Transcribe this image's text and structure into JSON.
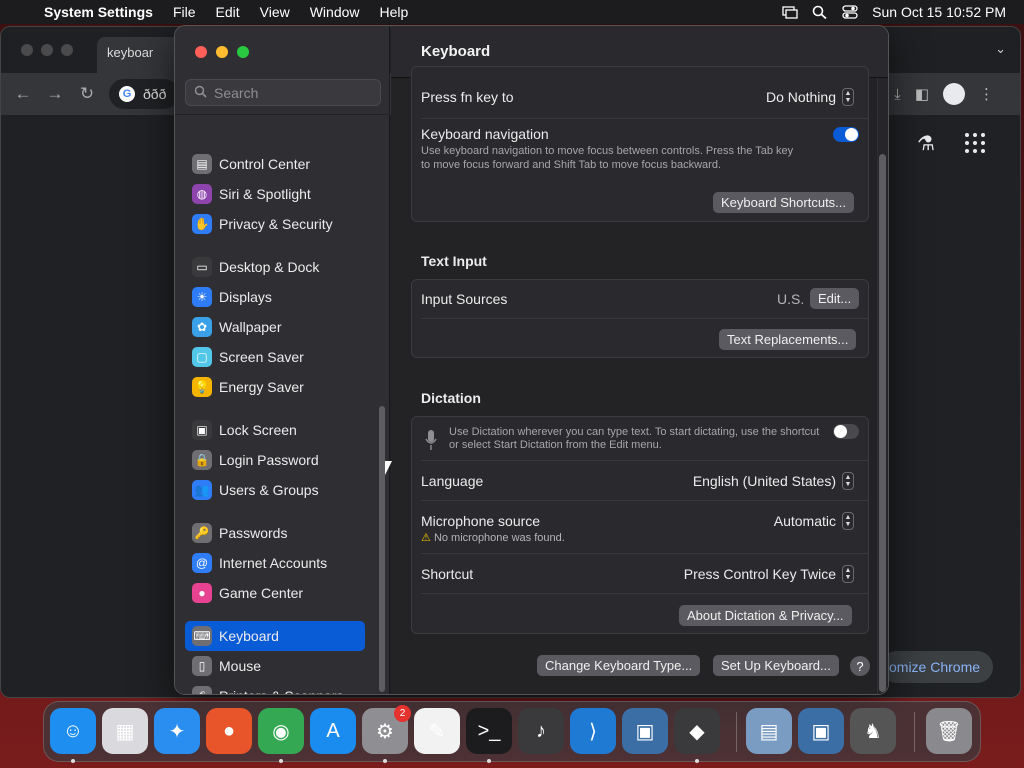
{
  "menubar": {
    "app": "System Settings",
    "items": [
      "File",
      "Edit",
      "View",
      "Window",
      "Help"
    ],
    "datetime": "Sun Oct 15  10:52 PM"
  },
  "chrome": {
    "tab_title": "keyboar",
    "omnibox_text": "ððð",
    "customize_label": "omize Chrome"
  },
  "sidebar": {
    "search_placeholder": "Search",
    "items": [
      {
        "label": "Control Center",
        "icon": "control-center-icon",
        "color": "#6e6e73"
      },
      {
        "label": "Siri & Spotlight",
        "icon": "siri-icon",
        "color": "#8e44ad"
      },
      {
        "label": "Privacy & Security",
        "icon": "hand-icon",
        "color": "#2e7cf6"
      },
      {
        "label": "Desktop & Dock",
        "icon": "dock-icon",
        "color": "#3a3a3c"
      },
      {
        "label": "Displays",
        "icon": "sun-icon",
        "color": "#2e7cf6"
      },
      {
        "label": "Wallpaper",
        "icon": "flower-icon",
        "color": "#3aa0e8"
      },
      {
        "label": "Screen Saver",
        "icon": "screen-saver-icon",
        "color": "#52c7e8"
      },
      {
        "label": "Energy Saver",
        "icon": "bulb-icon",
        "color": "#f4b400"
      },
      {
        "label": "Lock Screen",
        "icon": "lock-screen-icon",
        "color": "#3a3a3c"
      },
      {
        "label": "Login Password",
        "icon": "lock-icon",
        "color": "#6e6e73"
      },
      {
        "label": "Users & Groups",
        "icon": "users-icon",
        "color": "#2e7cf6"
      },
      {
        "label": "Passwords",
        "icon": "key-icon",
        "color": "#6e6e73"
      },
      {
        "label": "Internet Accounts",
        "icon": "at-icon",
        "color": "#2e7cf6"
      },
      {
        "label": "Game Center",
        "icon": "game-center-icon",
        "color": "#e84393"
      },
      {
        "label": "Keyboard",
        "icon": "keyboard-icon",
        "color": "#6e6e73"
      },
      {
        "label": "Mouse",
        "icon": "mouse-icon",
        "color": "#6e6e73"
      },
      {
        "label": "Printers & Scanners",
        "icon": "printer-icon",
        "color": "#6e6e73"
      }
    ],
    "selected": "Keyboard"
  },
  "main": {
    "title": "Keyboard",
    "fn_key": {
      "label": "Press fn key to",
      "value": "Do Nothing"
    },
    "keyboard_navigation": {
      "label": "Keyboard navigation",
      "description_1": "Use keyboard navigation to move focus between controls. Press the Tab key",
      "description_2": "to move focus forward and Shift Tab to move focus backward.",
      "enabled": true
    },
    "keyboard_shortcuts_button": "Keyboard Shortcuts...",
    "text_input": {
      "title": "Text Input",
      "input_sources_label": "Input Sources",
      "input_sources_value": "U.S.",
      "edit_button": "Edit...",
      "text_replacements_button": "Text Replacements..."
    },
    "dictation": {
      "title": "Dictation",
      "description_1": "Use Dictation wherever you can type text. To start dictating, use the shortcut",
      "description_2": "or select Start Dictation from the Edit menu.",
      "enabled": false,
      "language_label": "Language",
      "language_value": "English (United States)",
      "mic_label": "Microphone source",
      "mic_value": "Automatic",
      "mic_warning": "No microphone was found.",
      "shortcut_label": "Shortcut",
      "shortcut_value": "Press Control Key Twice",
      "about_button": "About Dictation & Privacy..."
    },
    "change_keyboard_button": "Change Keyboard Type...",
    "setup_keyboard_button": "Set Up Keyboard...",
    "help_label": "?"
  },
  "dock": {
    "items": [
      {
        "name": "finder-icon",
        "color": "#1e8ef0",
        "glyph": "☺"
      },
      {
        "name": "launchpad-icon",
        "color": "#d9d9de",
        "glyph": "▦"
      },
      {
        "name": "safari-icon",
        "color": "#2a8ef0",
        "glyph": "✦"
      },
      {
        "name": "firefox-icon",
        "color": "#e8552a",
        "glyph": "●"
      },
      {
        "name": "chrome-icon",
        "color": "#34a853",
        "glyph": "◉"
      },
      {
        "name": "app-store-icon",
        "color": "#1a8cf0",
        "glyph": "A"
      },
      {
        "name": "system-settings-icon",
        "color": "#8e8e93",
        "glyph": "⚙"
      },
      {
        "name": "textedit-icon",
        "color": "#f2f2f2",
        "glyph": "✎"
      },
      {
        "name": "terminal-icon",
        "color": "#1c1c1e",
        "glyph": ">_"
      },
      {
        "name": "garageband-icon",
        "color": "#3a3a3c",
        "glyph": "♪"
      },
      {
        "name": "vscode-icon",
        "color": "#1f7ad4",
        "glyph": "⟩"
      },
      {
        "name": "virtualbox-icon",
        "color": "#3a6ea5",
        "glyph": "▣"
      },
      {
        "name": "roblox-icon",
        "color": "#3a3a3c",
        "glyph": "◆"
      },
      {
        "name": "preview-icon",
        "color": "#7a9bc2",
        "glyph": "▤"
      },
      {
        "name": "virtualbox-2-icon",
        "color": "#3a6ea5",
        "glyph": "▣"
      },
      {
        "name": "chess-icon",
        "color": "#555",
        "glyph": "♞"
      },
      {
        "name": "trash-icon",
        "color": "#8a8a8e",
        "glyph": "🗑"
      }
    ],
    "settings_badge": "2"
  }
}
